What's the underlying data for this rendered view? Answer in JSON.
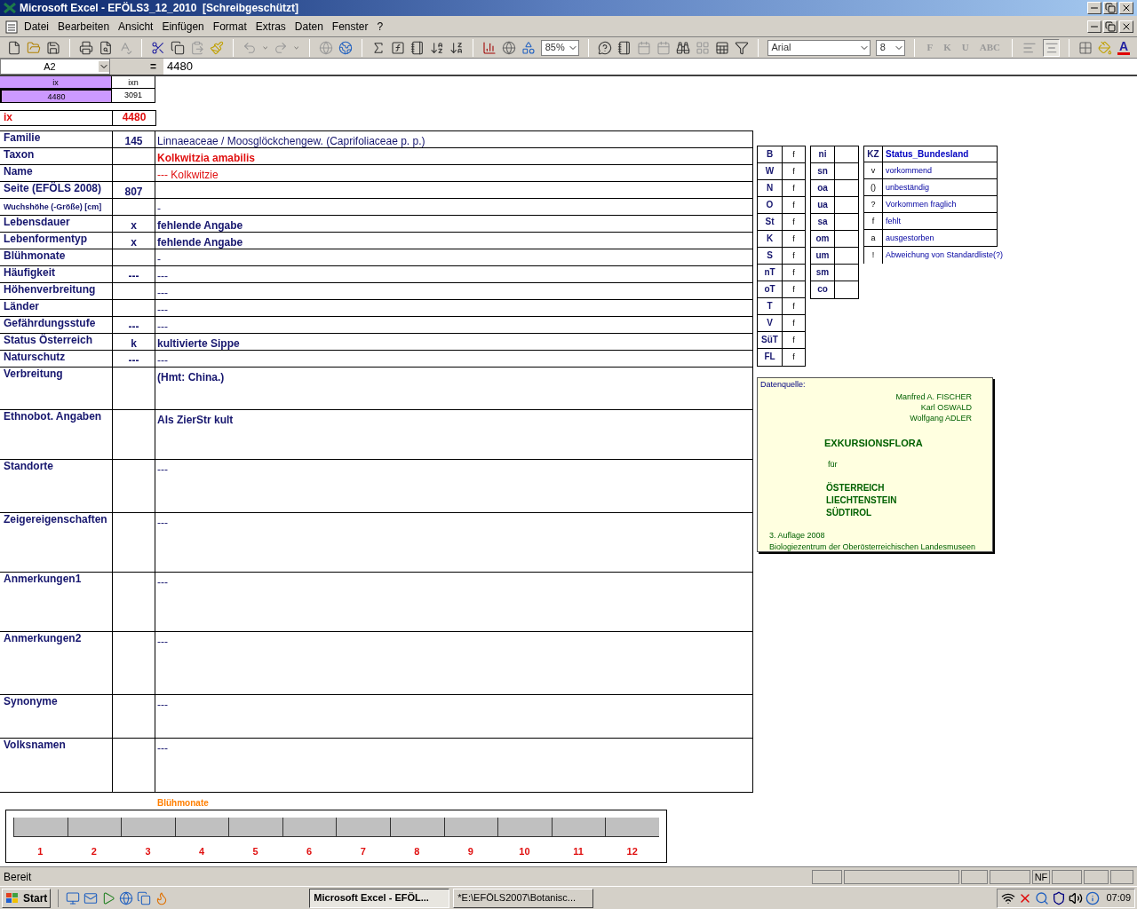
{
  "window": {
    "title": "Microsoft Excel - EFÖLS3_12_2010  [Schreibgeschützt]"
  },
  "menu": [
    "Datei",
    "Bearbeiten",
    "Ansicht",
    "Einfügen",
    "Format",
    "Extras",
    "Daten",
    "Fenster",
    "?"
  ],
  "toolbar": {
    "zoom": "85%",
    "font": "Arial",
    "font_size": "8",
    "format_buttons": [
      "F",
      "K",
      "U",
      "ABC"
    ],
    "align_buttons": [
      {
        "selected": false
      },
      {
        "selected": true
      }
    ],
    "font_color_button": "A"
  },
  "formula_bar": {
    "name_box": "A2",
    "equals": "=",
    "value": "4480"
  },
  "index_table": {
    "headers": [
      "ix",
      "ixn"
    ],
    "cells": [
      {
        "text": "4480",
        "selected": true
      },
      {
        "text": "3091",
        "selected": false
      }
    ]
  },
  "ix_row": {
    "label": "ix",
    "value": "4480"
  },
  "form": {
    "rows": [
      {
        "label": "Familie",
        "code": "145",
        "value": "Linnaeaceae  /  Moosglöckchengew. (Caprifoliaceae p. p.)",
        "kind": "plain"
      },
      {
        "label": "Taxon",
        "value": "Kolkwitzia amabilis",
        "kind": "taxon"
      },
      {
        "label": "Name",
        "value": "--- Kolkwitzie",
        "kind": "name"
      },
      {
        "label": "Seite (EFÖLS 2008)",
        "code": "807"
      },
      {
        "label": "**Wuchshöhe** (-Größe) [cm]",
        "value": "-",
        "kind": "plain"
      },
      {
        "label": "Lebensdauer",
        "code": "x",
        "value": "fehlende Angabe",
        "kind": "bold"
      },
      {
        "label": "Lebenformentyp",
        "code": "x",
        "value": "fehlende Angabe",
        "kind": "bold"
      },
      {
        "label": "Blühmonate",
        "value": "-",
        "kind": "plain"
      },
      {
        "label": "Häufigkeit",
        "code": "---",
        "value": "---",
        "kind": "plain"
      },
      {
        "label": "Höhenverbreitung",
        "value": "---",
        "kind": "plain"
      },
      {
        "label": "Länder",
        "value": "---",
        "kind": "plain"
      },
      {
        "label": "Gefährdungsstufe",
        "code": "---",
        "value": "---",
        "kind": "plain"
      },
      {
        "label": "Status Österreich",
        "code": "k",
        "value": "kultivierte Sippe",
        "kind": "bold"
      },
      {
        "label": "Naturschutz",
        "code": "---",
        "value": "---",
        "kind": "plain"
      },
      {
        "label": "Verbreitung",
        "value": "(Hmt: China.)",
        "kind": "bold"
      },
      {
        "label": "Ethnobot. Angaben",
        "value": "Als ZierStr kult",
        "kind": "bold"
      },
      {
        "label": "Standorte",
        "value": "---",
        "kind": "plain"
      },
      {
        "label": "Zeigereigenschaften",
        "value": "---",
        "kind": "plain"
      },
      {
        "label": "Anmerkungen1",
        "value": "---",
        "kind": "plain"
      },
      {
        "label": "Anmerkungen2",
        "value": "---",
        "kind": "plain"
      },
      {
        "label": "Synonyme",
        "value": "---",
        "kind": "plain"
      },
      {
        "label": "Volksnamen",
        "value": "---",
        "kind": "plain"
      }
    ]
  },
  "bloom_chart": {
    "title": "Blühmonate",
    "months": [
      "1",
      "2",
      "3",
      "4",
      "5",
      "6",
      "7",
      "8",
      "9",
      "10",
      "11",
      "12"
    ]
  },
  "region_table": [
    {
      "code": "B",
      "value": "f"
    },
    {
      "code": "W",
      "value": "f"
    },
    {
      "code": "N",
      "value": "f"
    },
    {
      "code": "O",
      "value": "f"
    },
    {
      "code": "St",
      "value": "f"
    },
    {
      "code": "K",
      "value": "f"
    },
    {
      "code": "S",
      "value": "f"
    },
    {
      "code": "nT",
      "value": "f"
    },
    {
      "code": "oT",
      "value": "f"
    },
    {
      "code": "T",
      "value": "f"
    },
    {
      "code": "V",
      "value": "f"
    },
    {
      "code": "SüT",
      "value": "f"
    },
    {
      "code": "FL",
      "value": "f"
    }
  ],
  "altitude_table": [
    "ni",
    "sn",
    "oa",
    "ua",
    "sa",
    "om",
    "um",
    "sm",
    "co"
  ],
  "status_legend": {
    "header": {
      "code": "KZ",
      "label": "Status_Bundesland"
    },
    "rows": [
      {
        "code": "v",
        "label": "vorkommend"
      },
      {
        "code": "()",
        "label": "unbeständig"
      },
      {
        "code": "?",
        "label": "Vorkommen fraglich"
      },
      {
        "code": "f",
        "label": "fehlt"
      },
      {
        "code": "a",
        "label": "ausgestorben"
      },
      {
        "code": "!",
        "label": "Abweichung von Standardliste(?)"
      }
    ]
  },
  "source_box": {
    "label": "Datenquelle:",
    "authors": [
      "Manfred A. FISCHER",
      "Karl OSWALD",
      "Wolfgang ADLER"
    ],
    "title": "EXKURSIONSFLORA",
    "for": "für",
    "regions": [
      "ÖSTERREICH",
      "LIECHTENSTEIN",
      "SÜDTIROL"
    ],
    "edition": "3. Auflage 2008",
    "publisher": "Biologiezentrum der Oberösterreichischen Landesmuseen"
  },
  "status_bar": {
    "text": "Bereit",
    "indicator": "NF"
  },
  "taskbar": {
    "start": "Start",
    "tasks": [
      {
        "label": "Microsoft Excel - EFÖL...",
        "selected": true
      },
      {
        "label": "*E:\\EFÖLS2007\\Botanisc...",
        "selected": false
      }
    ],
    "clock": "07:09"
  }
}
